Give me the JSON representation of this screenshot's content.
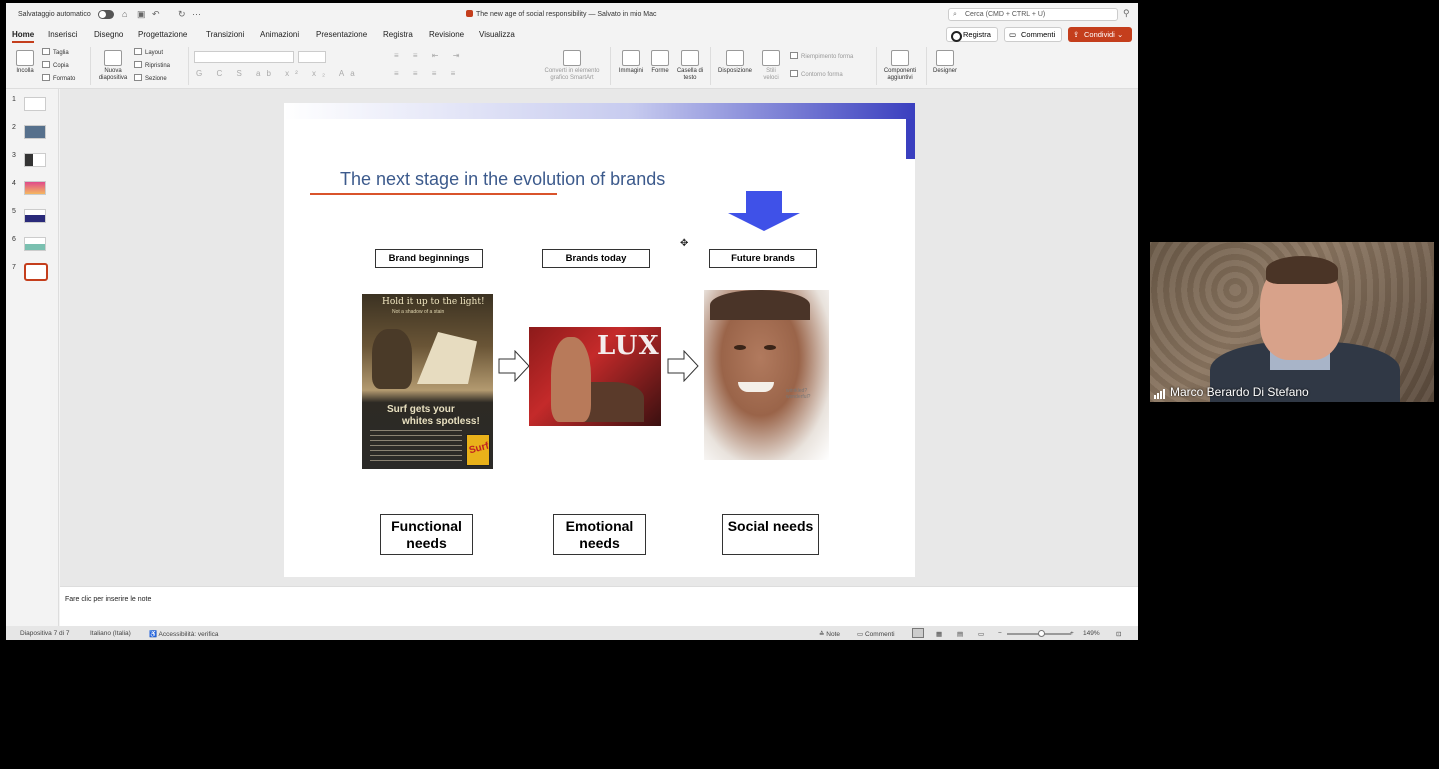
{
  "titlebar": {
    "autosave_label": "Salvataggio automatico",
    "document_title": "The new age of social responsibility — Salvato in mio Mac",
    "search_placeholder": "Cerca (CMD + CTRL + U)"
  },
  "menu": {
    "tabs": [
      "Home",
      "Inserisci",
      "Disegno",
      "Progettazione",
      "Transizioni",
      "Animazioni",
      "Presentazione",
      "Registra",
      "Revisione",
      "Visualizza"
    ],
    "active_tab": "Home",
    "record_button": "Registra",
    "comments_button": "Commenti",
    "share_button": "Condividi"
  },
  "ribbon": {
    "paste": "Incolla",
    "cut": "Taglia",
    "copy": "Copia",
    "format": "Formato",
    "new_slide": "Nuova diapositiva",
    "layout": "Layout",
    "reset": "Ripristina",
    "section": "Sezione",
    "smartart": "Converti in elemento grafico SmartArt",
    "images": "Immagini",
    "shapes": "Forme",
    "textbox": "Casella di testo",
    "arrange": "Disposizione",
    "quick_styles": "Stili veloci",
    "shape_fill": "Riempimento forma",
    "shape_outline": "Contorno forma",
    "addins": "Componenti aggiuntivi",
    "designer": "Designer"
  },
  "thumbnails": [
    "1",
    "2",
    "3",
    "4",
    "5",
    "6",
    "7"
  ],
  "selected_slide": 7,
  "slide": {
    "title": "The next stage in the evolution of brands",
    "labels": [
      "Brand beginnings",
      "Brands today",
      "Future brands"
    ],
    "needs": [
      "Functional needs",
      "Emotional needs",
      "Social needs"
    ],
    "ad_headline": "Hold it up to the light!",
    "ad_sub": "Not a shadow of a stain",
    "ad_slogan_1": "Surf gets your",
    "ad_slogan_2": "whites spotless!",
    "ad_brand": "Surf",
    "lux_brand": "LUX",
    "face_note": "wrinkled? wonderful?"
  },
  "notes": {
    "placeholder": "Fare clic per inserire le note"
  },
  "status": {
    "slide_counter": "Diapositiva 7 di 7",
    "language": "Italiano (Italia)",
    "accessibility": "Accessibilità: verifica",
    "notes": "Note",
    "comments": "Commenti",
    "zoom": "149%"
  },
  "video": {
    "participant_name": "Marco Berardo Di Stefano"
  },
  "colors": {
    "accent": "#c43e1c",
    "title": "#3c5a8c",
    "arrow_blue": "#3f51e8"
  }
}
